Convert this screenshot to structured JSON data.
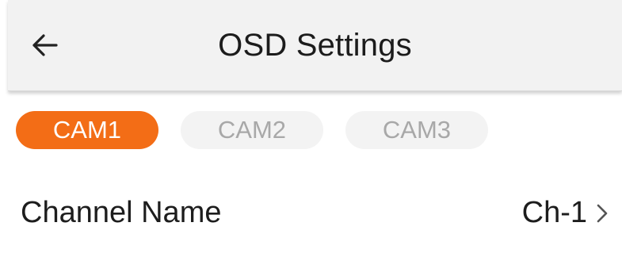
{
  "header": {
    "title": "OSD Settings",
    "back_icon": "arrow-left-icon"
  },
  "tabs": [
    {
      "label": "CAM1",
      "active": true
    },
    {
      "label": "CAM2",
      "active": false
    },
    {
      "label": "CAM3",
      "active": false
    }
  ],
  "settings": {
    "channel_name": {
      "label": "Channel Name",
      "value": "Ch-1",
      "icon": "chevron-right-icon"
    }
  },
  "colors": {
    "accent": "#f36d16",
    "header_bg": "#f2f2f2",
    "inactive_tab_bg": "#f3f3f3",
    "inactive_tab_text": "#a8a8a8"
  }
}
